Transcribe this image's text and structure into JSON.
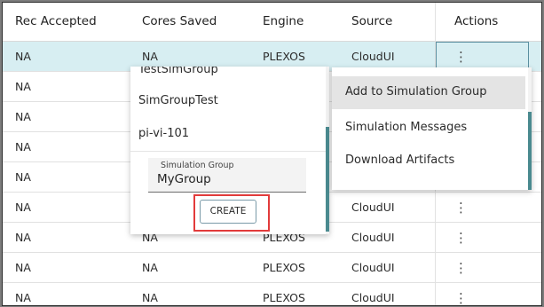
{
  "table": {
    "columns": [
      "Rec Accepted",
      "Cores Saved",
      "Engine",
      "Source",
      "Actions"
    ],
    "rows": [
      {
        "rec": "NA",
        "cores": "NA",
        "engine": "PLEXOS",
        "source": "CloudUI",
        "actions": "⋮"
      },
      {
        "rec": "NA",
        "cores": "",
        "engine": "",
        "source": "",
        "actions": ""
      },
      {
        "rec": "NA",
        "cores": "",
        "engine": "",
        "source": "",
        "actions": ""
      },
      {
        "rec": "NA",
        "cores": "",
        "engine": "",
        "source": "",
        "actions": ""
      },
      {
        "rec": "NA",
        "cores": "",
        "engine": "",
        "source": "",
        "actions": ""
      },
      {
        "rec": "NA",
        "cores": "",
        "engine": "",
        "source": "CloudUI",
        "actions": "⋮"
      },
      {
        "rec": "NA",
        "cores": "NA",
        "engine": "PLEXOS",
        "source": "CloudUI",
        "actions": "⋮"
      },
      {
        "rec": "NA",
        "cores": "NA",
        "engine": "PLEXOS",
        "source": "CloudUI",
        "actions": "⋮"
      },
      {
        "rec": "NA",
        "cores": "NA",
        "engine": "PLEXOS",
        "source": "CloudUI",
        "actions": "⋮"
      }
    ]
  },
  "group_dropdown": {
    "items": [
      "TestSimGroup",
      "SimGroupTest",
      "pi-vi-101"
    ],
    "field_label": "Simulation Group",
    "field_value": "MyGroup",
    "create_label": "CREATE"
  },
  "actions_menu": {
    "items": [
      "Add to Simulation Group",
      "Simulation Messages",
      "Download Artifacts"
    ]
  },
  "colors": {
    "accent": "#4a8a8f",
    "selected_row": "#d7eef2",
    "highlight": "#e23b3b"
  }
}
